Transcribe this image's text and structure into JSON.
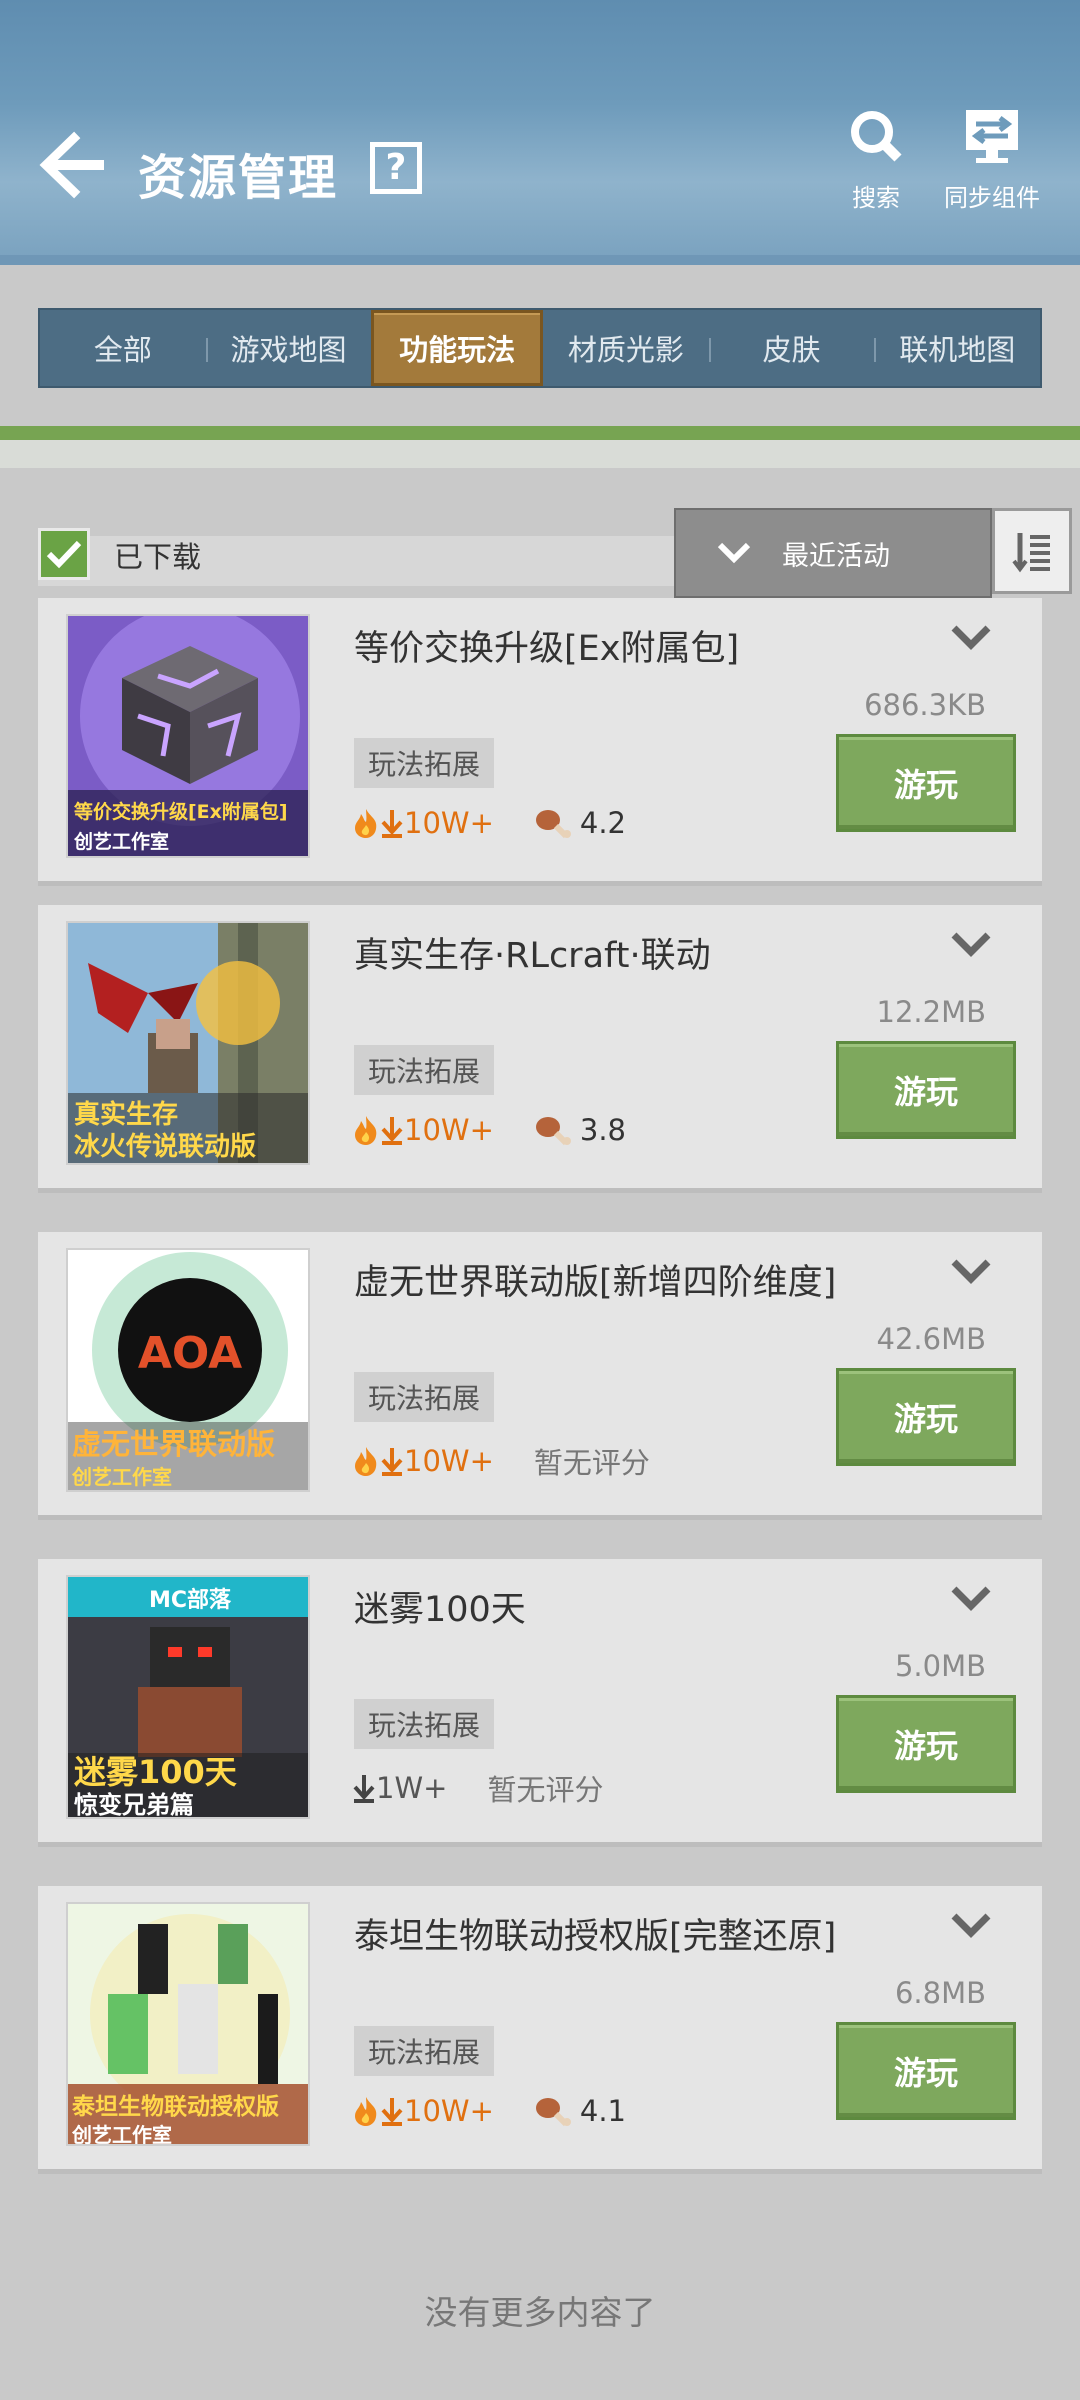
{
  "header": {
    "title": "资源管理",
    "help": "?",
    "actions": {
      "search": "搜索",
      "sync": "同步组件"
    }
  },
  "tabs": [
    {
      "label": "全部",
      "active": false
    },
    {
      "label": "游戏地图",
      "active": false
    },
    {
      "label": "功能玩法",
      "active": true
    },
    {
      "label": "材质光影",
      "active": false
    },
    {
      "label": "皮肤",
      "active": false
    },
    {
      "label": "联机地图",
      "active": false
    }
  ],
  "filter": {
    "downloaded_label": "已下载",
    "downloaded_checked": true,
    "sort_label": "最近活动"
  },
  "items": [
    {
      "title": "等价交换升级[Ex附属包]",
      "size": "686.3KB",
      "tag": "玩法拓展",
      "downloads": "10W+",
      "hot": true,
      "rating": "4.2",
      "play": "游玩",
      "thumb_line1": "等价交换升级[Ex附属包]",
      "thumb_line2": "创艺工作室"
    },
    {
      "title": "真实生存·RLcraft·联动",
      "size": "12.2MB",
      "tag": "玩法拓展",
      "downloads": "10W+",
      "hot": true,
      "rating": "3.8",
      "play": "游玩",
      "thumb_line1": "真实生存",
      "thumb_line2": "冰火传说联动版"
    },
    {
      "title": "虚无世界联动版[新增四阶维度]",
      "size": "42.6MB",
      "tag": "玩法拓展",
      "downloads": "10W+",
      "hot": true,
      "rating": "暂无评分",
      "play": "游玩",
      "thumb_line1": "虚无世界联动版",
      "thumb_line2": "创艺工作室",
      "thumb_logo": "AOA"
    },
    {
      "title": "迷雾100天",
      "size": "5.0MB",
      "tag": "玩法拓展",
      "downloads": "1W+",
      "hot": false,
      "rating": "暂无评分",
      "play": "游玩",
      "thumb_line1": "迷雾100天",
      "thumb_line2": "惊变兄弟篇",
      "thumb_logo": "MC部落"
    },
    {
      "title": "泰坦生物联动授权版[完整还原]",
      "size": "6.8MB",
      "tag": "玩法拓展",
      "downloads": "10W+",
      "hot": true,
      "rating": "4.1",
      "play": "游玩",
      "thumb_line1": "泰坦生物联动授权版",
      "thumb_line2": "创艺工作室"
    }
  ],
  "footer": "没有更多内容了",
  "colors": {
    "accent_green": "#7ea85d",
    "active_tab": "#a37a3b",
    "header_blue": "#6e9bbb"
  }
}
